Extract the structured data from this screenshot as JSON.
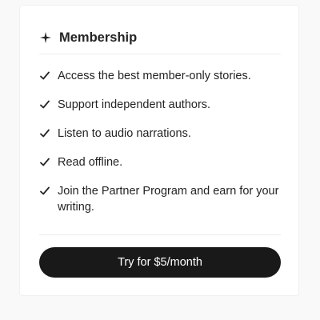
{
  "membership": {
    "title": "Membership",
    "icon": "sparkle-icon",
    "features": [
      {
        "icon": "checkmark-icon",
        "label": "Access the best member-only stories."
      },
      {
        "icon": "checkmark-icon",
        "label": "Support independent authors."
      },
      {
        "icon": "checkmark-icon",
        "label": "Listen to audio narrations."
      },
      {
        "icon": "checkmark-icon",
        "label": "Read offline."
      },
      {
        "icon": "checkmark-icon",
        "label": "Join the Partner Program and earn for your writing."
      }
    ],
    "cta_label": "Try for $5/month"
  },
  "colors": {
    "text": "#242424",
    "button_bg": "#191919",
    "button_text": "#ffffff",
    "page_bg": "#f9f9f9",
    "card_bg": "#ffffff",
    "divider": "#ececec"
  }
}
